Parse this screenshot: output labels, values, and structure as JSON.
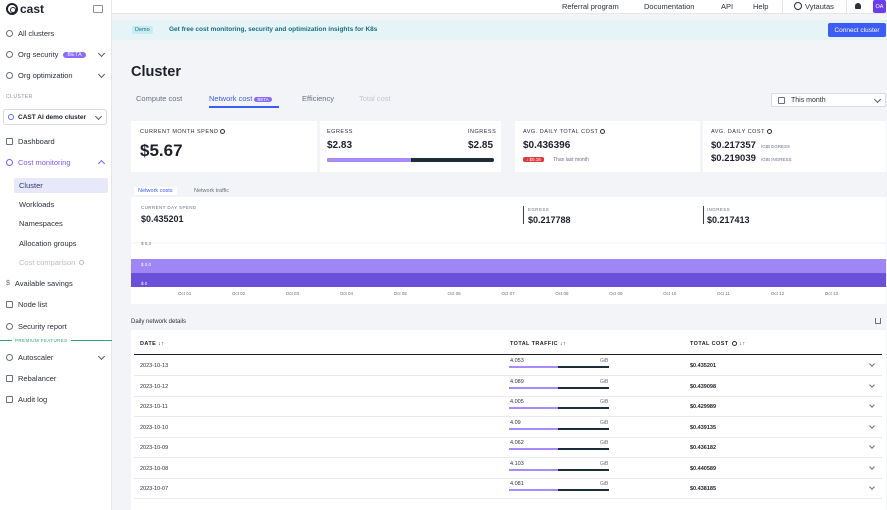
{
  "brand": {
    "logo_text": "cast"
  },
  "sidebar": {
    "all_clusters": "All clusters",
    "org_security": "Org security",
    "org_security_badge": "BETA",
    "org_optimization": "Org optimization",
    "cluster_section": "CLUSTER",
    "cluster_name": "CAST AI demo cluster",
    "dashboard": "Dashboard",
    "cost_monitoring": "Cost monitoring",
    "sub_items": [
      "Cluster",
      "Workloads",
      "Namespaces",
      "Allocation groups",
      "Cost comparison"
    ],
    "available_savings": "Available savings",
    "node_list": "Node list",
    "security_report": "Security report",
    "premium_label": "PREMIUM FEATURES",
    "autoscaler": "Autoscaler",
    "rebalancer": "Rebalancer",
    "audit_log": "Audit log"
  },
  "topbar": {
    "referral": "Referral program",
    "documentation": "Documentation",
    "api": "API",
    "help": "Help",
    "user": "Vytautas",
    "avatar": "OA"
  },
  "banner": {
    "badge": "Demo",
    "text": "Get free cost monitoring, security and optimization insights for K8s",
    "button": "Connect cluster"
  },
  "page": {
    "title": "Cluster",
    "tabs": [
      "Compute cost",
      "Network cost",
      "Efficiency",
      "Total cost"
    ],
    "tab_badge": "BETA",
    "date_range": "This month"
  },
  "cards": {
    "current_month_label": "CURRENT MONTH SPEND",
    "current_month_value": "$5.67",
    "egress_label": "EGRESS",
    "ingress_label": "INGRESS",
    "egress_value": "$2.83",
    "ingress_value": "$2.85",
    "egress_share": 0.5,
    "avg_daily_total_label": "AVG. DAILY TOTAL COST",
    "avg_daily_total_value": "$0.436396",
    "change_badge": "↓ $0.18",
    "change_text": "Than last month",
    "avg_daily_label": "AVG. DAILY COST",
    "avg_egress_value": "$0.217357",
    "avg_egress_unit": "/GIB EGRESS",
    "avg_ingress_value": "$0.219039",
    "avg_ingress_unit": "/GIB INGRESS"
  },
  "graph": {
    "subtabs": [
      "Network costs",
      "Network traffic"
    ],
    "current_day_label": "CURRENT DAY SPEND",
    "current_day_value": "$0.435201",
    "egress_label": "EGRESS",
    "egress_value": "$0.217788",
    "ingress_label": "INGRESS",
    "ingress_value": "$0.217413",
    "y_ticks": [
      "$ 0.3",
      "$ 0.0",
      "$ 0"
    ],
    "x_ticks": [
      "Oct 01",
      "Oct 02",
      "Oct 03",
      "Oct 04",
      "Oct 05",
      "Oct 06",
      "Oct 07",
      "Oct 08",
      "Oct 09",
      "Oct 10",
      "Oct 11",
      "Oct 12",
      "Oct 13"
    ],
    "colors": {
      "egress": "#9f86f5",
      "ingress": "#6a4fd8"
    }
  },
  "table": {
    "title": "Daily network details",
    "headers": {
      "date": "DATE",
      "traffic": "TOTAL TRAFFIC",
      "cost": "TOTAL COST"
    },
    "unit": "GiB",
    "rows": [
      {
        "date": "2023-10-13",
        "traffic": "4.053",
        "cost": "$0.435201",
        "fill": 0.49
      },
      {
        "date": "2023-10-12",
        "traffic": "4.089",
        "cost": "$0.439098",
        "fill": 0.49
      },
      {
        "date": "2023-10-11",
        "traffic": "4.005",
        "cost": "$0.429989",
        "fill": 0.49
      },
      {
        "date": "2023-10-10",
        "traffic": "4.09",
        "cost": "$0.439135",
        "fill": 0.49
      },
      {
        "date": "2023-10-09",
        "traffic": "4.062",
        "cost": "$0.436182",
        "fill": 0.49
      },
      {
        "date": "2023-10-08",
        "traffic": "4.103",
        "cost": "$0.440589",
        "fill": 0.49
      },
      {
        "date": "2023-10-07",
        "traffic": "4.081",
        "cost": "$0.438185",
        "fill": 0.49
      }
    ]
  }
}
